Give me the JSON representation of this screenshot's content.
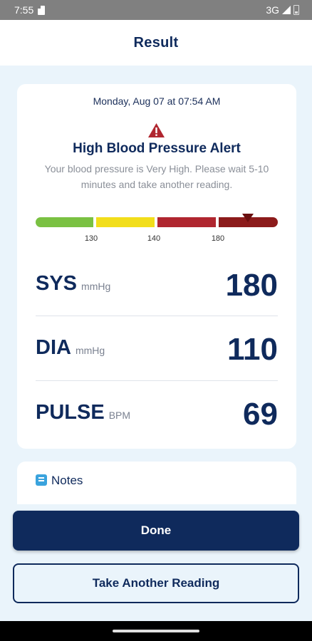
{
  "status_bar": {
    "time": "7:55",
    "network": "3G"
  },
  "header": {
    "title": "Result"
  },
  "result": {
    "date": "Monday, Aug 07 at 07:54 AM",
    "alert_title": "High Blood Pressure Alert",
    "alert_message": "Your blood pressure is Very High. Please wait 5-10 minutes and take another reading.",
    "scale": {
      "ticks": [
        "130",
        "140",
        "180"
      ],
      "colors": [
        "#7ac142",
        "#f2de1b",
        "#b0262f",
        "#8c1b1b"
      ]
    },
    "readings": [
      {
        "label": "SYS",
        "unit": "mmHg",
        "value": "180"
      },
      {
        "label": "DIA",
        "unit": "mmHg",
        "value": "110"
      },
      {
        "label": "PULSE",
        "unit": "BPM",
        "value": "69"
      }
    ]
  },
  "notes": {
    "label": "Notes",
    "icon": "notes-icon"
  },
  "actions": {
    "done_label": "Done",
    "another_label": "Take Another Reading"
  },
  "colors": {
    "primary": "#0f2a5c",
    "background": "#eaf4fb",
    "alert": "#b0262f"
  }
}
